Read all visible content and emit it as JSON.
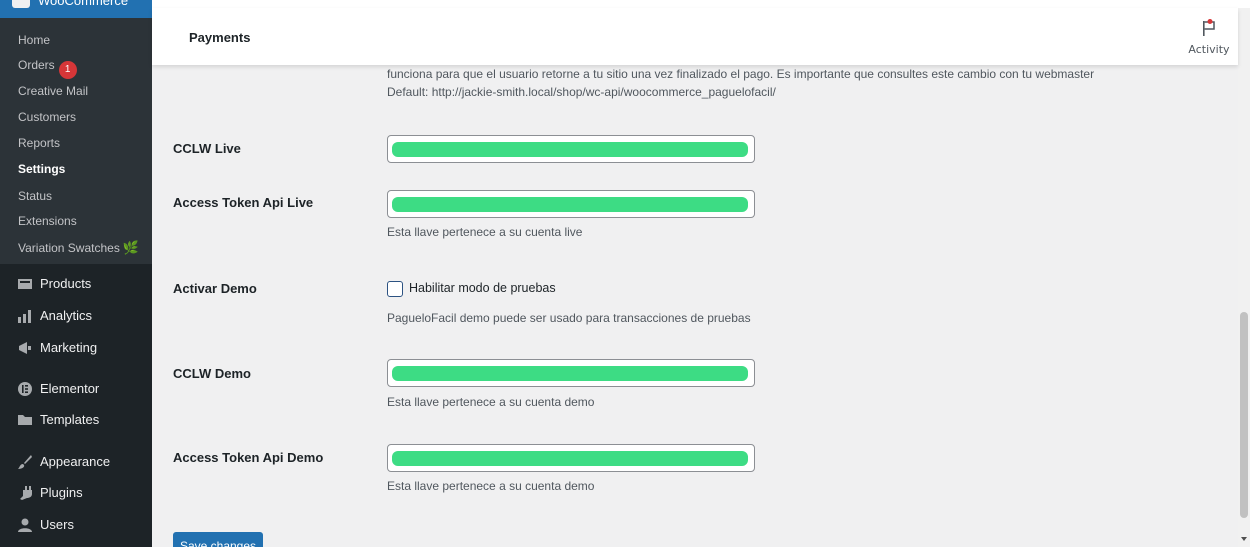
{
  "sidebar": {
    "top_label": "WooCommerce",
    "sub_items": [
      {
        "label": "Home"
      },
      {
        "label": "Orders",
        "badge": "1"
      },
      {
        "label": "Creative Mail"
      },
      {
        "label": "Customers"
      },
      {
        "label": "Reports"
      },
      {
        "label": "Settings"
      },
      {
        "label": "Status"
      },
      {
        "label": "Extensions"
      },
      {
        "label": "Variation Swatches"
      }
    ],
    "main_items": [
      {
        "label": "Products",
        "icon": "products-icon"
      },
      {
        "label": "Analytics",
        "icon": "analytics-icon"
      },
      {
        "label": "Marketing",
        "icon": "megaphone-icon"
      },
      {
        "label": "Elementor",
        "icon": "elementor-icon"
      },
      {
        "label": "Templates",
        "icon": "folder-icon"
      },
      {
        "label": "Appearance",
        "icon": "paintbrush-icon"
      },
      {
        "label": "Plugins",
        "icon": "plugin-icon"
      },
      {
        "label": "Users",
        "icon": "user-icon"
      }
    ]
  },
  "header": {
    "title": "Payments",
    "activity_label": "Activity"
  },
  "settings": {
    "return_desc_line1": "funciona para que el usuario retorne a tu sitio una vez finalizado el pago. Es importante que consultes este cambio con tu webmaster",
    "return_desc_line2": "Default: http://jackie-smith.local/shop/wc-api/woocommerce_paguelofacil/",
    "cclw_live_label": "CCLW Live",
    "token_live_label": "Access Token Api Live",
    "token_live_desc": "Esta llave pertenece a su cuenta live",
    "demo_label": "Activar Demo",
    "demo_checkbox_label": "Habilitar modo de pruebas",
    "demo_desc": "PagueloFacil demo puede ser usado para transacciones de pruebas",
    "cclw_demo_label": "CCLW Demo",
    "cclw_demo_desc": "Esta llave pertenece a su cuenta demo",
    "token_demo_label": "Access Token Api Demo",
    "token_demo_desc": "Esta llave pertenece a su cuenta demo",
    "save_label": "Save changes"
  },
  "colors": {
    "sidebar_bg": "#1d2327",
    "submenu_bg": "#2c3338",
    "accent": "#2271b1",
    "redaction": "#3ddc84",
    "badge": "#d63638"
  }
}
